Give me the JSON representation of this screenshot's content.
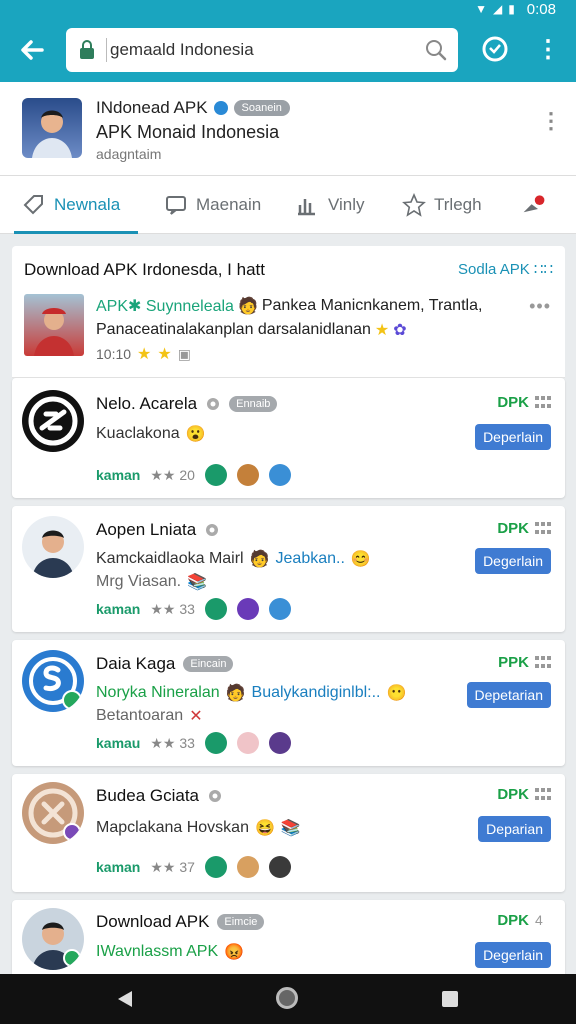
{
  "status": {
    "time": "0:08"
  },
  "appbar": {
    "search_text": "gemaald Indonesia"
  },
  "header": {
    "title": "INdonead APK",
    "badge": "Soanein",
    "subtitle": "APK Monaid Indonesia",
    "meta": "adagntaim"
  },
  "tabs": [
    {
      "label": "Newnala",
      "icon": "tag-icon"
    },
    {
      "label": "Maenain",
      "icon": "chat-icon"
    },
    {
      "label": "Vinly",
      "icon": "chart-icon"
    },
    {
      "label": "Trlegh",
      "icon": "star-icon"
    },
    {
      "label": "",
      "icon": "notification-icon"
    }
  ],
  "featured": {
    "title": "Download APK Irdonesda, I hatt",
    "link": "Sodla APK",
    "line1_accent": "APK✱ Suynneleala",
    "line1_rest": "Pankea Manicnkanem, Trantla,",
    "line2": "Panaceatinalakanplan darsalanidlanan",
    "meta": "10:10"
  },
  "cards": [
    {
      "title": "Nelo. Acarela",
      "chip": "Ennaib",
      "tag": "DPK",
      "line1": "Kuaclakona",
      "line2": "",
      "button": "Deperlain",
      "author": "kaman",
      "rating": "★★ 20"
    },
    {
      "title": "Aopen Lniata",
      "chip": "",
      "tag": "DPK",
      "line1": "Kamckaidlaoka Mairl",
      "line1_accent": "Jeabkan..",
      "line2": "Mrg Viasan.",
      "button": "Degerlain",
      "author": "kaman",
      "rating": "★★ 33"
    },
    {
      "title": "Daia Kaga",
      "chip": "Eincain",
      "tag": "PPK",
      "line1": "Noryka Nineralan",
      "line1_accent": "Bualykandiginlbl:..",
      "line2": "Betantoaran",
      "button": "Depetarian",
      "author": "kamau",
      "rating": "★★ 33"
    },
    {
      "title": "Budea Gciata",
      "chip": "",
      "tag": "DPK",
      "line1": "Mapclakana Hovskan",
      "line2": "",
      "button": "Deparian",
      "author": "kaman",
      "rating": "★★ 37"
    },
    {
      "title": "Download APK",
      "chip": "Eimcie",
      "tag": "DPK",
      "tag_extra": "4",
      "line1": "IWavnlassm APK",
      "line2": "",
      "button": "Degerlain",
      "author": "",
      "rating": ""
    }
  ],
  "colors": {
    "primary": "#1aa5bf",
    "accent": "#1a91b5",
    "button": "#3f7bd2",
    "green": "#1aa047"
  }
}
